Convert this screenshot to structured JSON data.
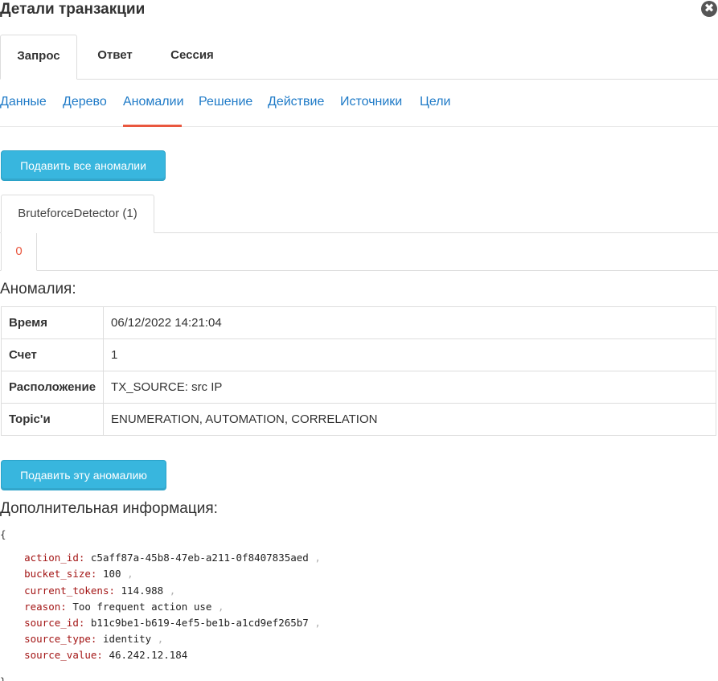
{
  "header": {
    "title": "Детали транзакции",
    "close_glyph": "✖"
  },
  "primary_tabs": [
    {
      "label": "Запрос",
      "active": true
    },
    {
      "label": "Ответ",
      "active": false
    },
    {
      "label": "Сессия",
      "active": false
    }
  ],
  "secondary_nav": [
    {
      "label": "Данные",
      "active": false
    },
    {
      "label": "Дерево",
      "active": false
    },
    {
      "label": "Аномалии",
      "active": true
    },
    {
      "label": "Решение",
      "active": false
    },
    {
      "label": "Действие",
      "active": false
    },
    {
      "label": "Источники",
      "active": false
    },
    {
      "label": "Цели",
      "active": false
    }
  ],
  "submit_all_label": "Подавить все аномалии",
  "detector_tab": "BruteforceDetector (1)",
  "anomaly_index_tab": "0",
  "anomaly_heading": "Аномалия:",
  "anomaly_table": [
    {
      "key": "Время",
      "value": "06/12/2022 14:21:04"
    },
    {
      "key": "Счет",
      "value": "1"
    },
    {
      "key": "Расположение",
      "value": "TX_SOURCE: src IP"
    },
    {
      "key": "Topic'и",
      "value": "ENUMERATION, AUTOMATION, CORRELATION"
    }
  ],
  "submit_one_label": "Подавить эту аномалию",
  "extra_heading": "Дополнительная информация:",
  "extra_info": {
    "open": "{",
    "close": "}",
    "entries": [
      {
        "key": "action_id",
        "value": "c5aff87a-45b8-47eb-a211-0f8407835aed"
      },
      {
        "key": "bucket_size",
        "value": "100"
      },
      {
        "key": "current_tokens",
        "value": "114.988"
      },
      {
        "key": "reason",
        "value": "Too frequent action use"
      },
      {
        "key": "source_id",
        "value": "b11c9be1-b619-4ef5-be1b-a1cd9ef265b7"
      },
      {
        "key": "source_type",
        "value": "identity"
      },
      {
        "key": "source_value",
        "value": "46.242.12.184"
      }
    ]
  },
  "colors": {
    "link": "#1e7ac7",
    "active_underline": "#e9573f",
    "button": "#38b6de",
    "json_key": "#a31515"
  }
}
